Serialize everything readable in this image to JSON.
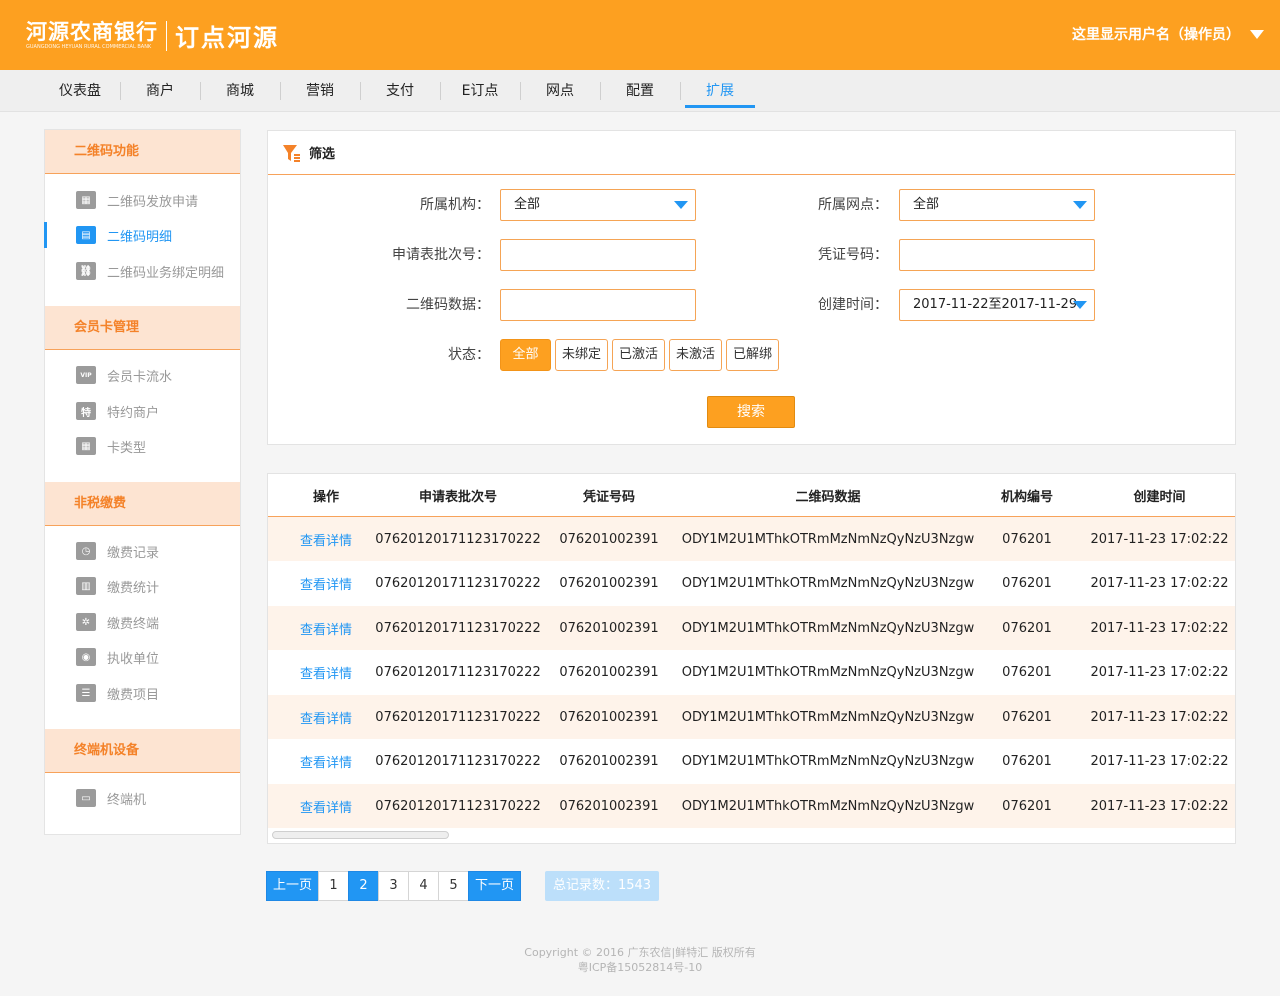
{
  "header": {
    "bank_name": "河源农商银行",
    "bank_name_en": "GUANGDONG HEYUAN RURAL COMMERCIAL BANK",
    "app_name": "订点河源",
    "user_label": "这里显示用户名（操作员）"
  },
  "nav": {
    "items": [
      "仪表盘",
      "商户",
      "商城",
      "营销",
      "支付",
      "E订点",
      "网点",
      "配置",
      "扩展"
    ],
    "active": "扩展"
  },
  "sidebar": {
    "sections": [
      {
        "title": "二维码功能",
        "items": [
          {
            "label": "二维码发放申请",
            "icon": "qr-apply-icon"
          },
          {
            "label": "二维码明细",
            "icon": "qr-detail-icon",
            "active": true
          },
          {
            "label": "二维码业务绑定明细",
            "icon": "link-icon"
          }
        ]
      },
      {
        "title": "会员卡管理",
        "items": [
          {
            "label": "会员卡流水",
            "icon": "vip-card-icon"
          },
          {
            "label": "特约商户",
            "icon": "special-merchant-icon"
          },
          {
            "label": "卡类型",
            "icon": "card-type-icon"
          }
        ]
      },
      {
        "title": "非税缴费",
        "items": [
          {
            "label": "缴费记录",
            "icon": "clock-icon"
          },
          {
            "label": "缴费统计",
            "icon": "stats-icon"
          },
          {
            "label": "缴费终端",
            "icon": "terminal-settings-icon"
          },
          {
            "label": "执收单位",
            "icon": "unit-icon"
          },
          {
            "label": "缴费项目",
            "icon": "list-icon"
          }
        ]
      },
      {
        "title": "终端机设备",
        "items": [
          {
            "label": "终端机",
            "icon": "monitor-icon"
          }
        ]
      }
    ],
    "icon_glyphs": {
      "qr-apply-icon": "▦",
      "qr-detail-icon": "▤",
      "link-icon": "⛓",
      "vip-card-icon": "VIP",
      "special-merchant-icon": "特",
      "card-type-icon": "▦",
      "clock-icon": "◷",
      "stats-icon": "▥",
      "terminal-settings-icon": "✲",
      "unit-icon": "◉",
      "list-icon": "☰",
      "monitor-icon": "▭"
    }
  },
  "filter": {
    "title": "筛选",
    "org_label": "所属机构：",
    "org_value": "全部",
    "branch_label": "所属网点：",
    "branch_value": "全部",
    "batch_label": "申请表批次号：",
    "batch_value": "",
    "voucher_label": "凭证号码：",
    "voucher_value": "",
    "qrdata_label": "二维码数据：",
    "qrdata_value": "",
    "created_label": "创建时间：",
    "created_value": "2017-11-22至2017-11-29",
    "status_label": "状态：",
    "status_options": [
      "全部",
      "未绑定",
      "已激活",
      "未激活",
      "已解绑"
    ],
    "status_selected": "全部",
    "search_label": "搜索"
  },
  "table": {
    "columns": [
      "操作",
      "申请表批次号",
      "凭证号码",
      "二维码数据",
      "机构编号",
      "创建时间"
    ],
    "rows": [
      [
        "查看详情",
        "07620120171123170222",
        "076201002391",
        "ODY1M2U1MThkOTRmMzNmNzQyNzU3Nzgw",
        "076201",
        "2017-11-23 17:02:22"
      ],
      [
        "查看详情",
        "07620120171123170222",
        "076201002391",
        "ODY1M2U1MThkOTRmMzNmNzQyNzU3Nzgw",
        "076201",
        "2017-11-23 17:02:22"
      ],
      [
        "查看详情",
        "07620120171123170222",
        "076201002391",
        "ODY1M2U1MThkOTRmMzNmNzQyNzU3Nzgw",
        "076201",
        "2017-11-23 17:02:22"
      ],
      [
        "查看详情",
        "07620120171123170222",
        "076201002391",
        "ODY1M2U1MThkOTRmMzNmNzQyNzU3Nzgw",
        "076201",
        "2017-11-23 17:02:22"
      ],
      [
        "查看详情",
        "07620120171123170222",
        "076201002391",
        "ODY1M2U1MThkOTRmMzNmNzQyNzU3Nzgw",
        "076201",
        "2017-11-23 17:02:22"
      ],
      [
        "查看详情",
        "07620120171123170222",
        "076201002391",
        "ODY1M2U1MThkOTRmMzNmNzQyNzU3Nzgw",
        "076201",
        "2017-11-23 17:02:22"
      ],
      [
        "查看详情",
        "07620120171123170222",
        "076201002391",
        "ODY1M2U1MThkOTRmMzNmNzQyNzU3Nzgw",
        "076201",
        "2017-11-23 17:02:22"
      ]
    ]
  },
  "pagination": {
    "prev_label": "上一页",
    "pages": [
      "1",
      "2",
      "3",
      "4",
      "5"
    ],
    "current": "2",
    "next_label": "下一页",
    "total_label": "总记录数：1543"
  },
  "footer": {
    "copyright": "Copyright © 2016 广东农信|鲜特汇 版权所有",
    "icp": "粤ICP备15052814号-10"
  },
  "colors": {
    "brand_orange": "#fda020",
    "accent_blue": "#2196f3",
    "section_bg": "#fde4d2",
    "row_stripe": "#fef3ea"
  }
}
